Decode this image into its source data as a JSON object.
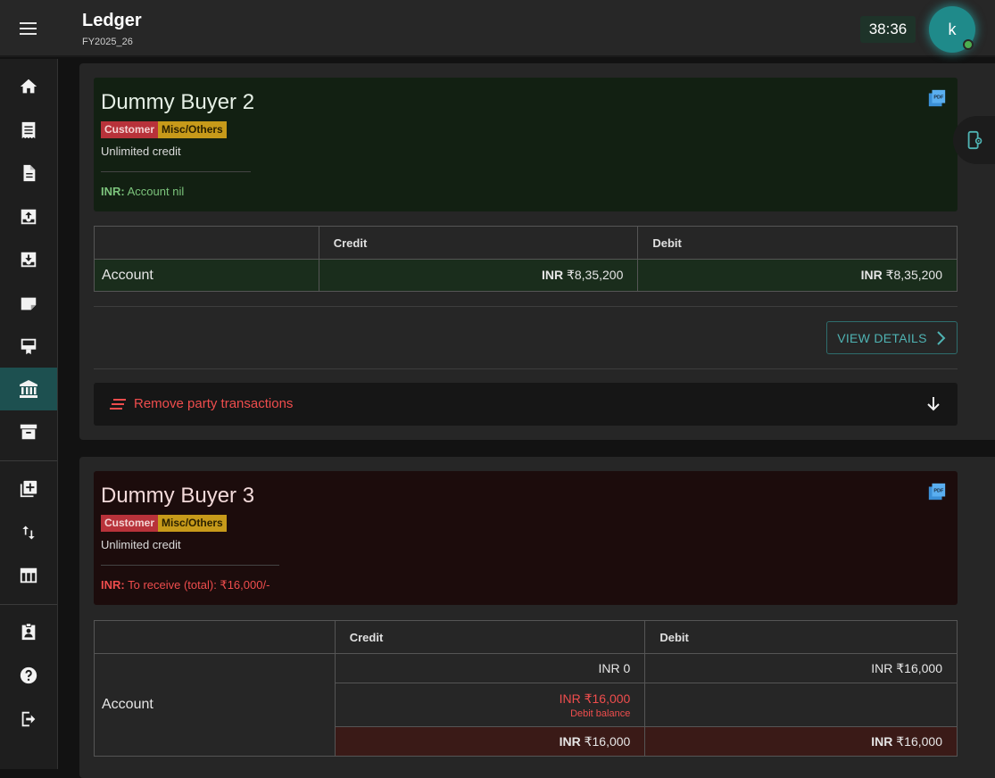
{
  "header": {
    "title": "Ledger",
    "subtitle": "FY2025_26",
    "timer": "38:36",
    "avatar_letter": "k"
  },
  "sidebar": {
    "items": [
      {
        "icon": "home-icon"
      },
      {
        "icon": "receipt-icon"
      },
      {
        "icon": "document-icon"
      },
      {
        "icon": "inbox-upload-icon"
      },
      {
        "icon": "inbox-download-icon"
      },
      {
        "icon": "note-icon"
      },
      {
        "icon": "desk-icon"
      },
      {
        "icon": "bank-icon",
        "active": true
      },
      {
        "icon": "archive-icon"
      },
      {
        "icon": "add-library-icon"
      },
      {
        "icon": "swap-vert-icon"
      },
      {
        "icon": "table-icon"
      },
      {
        "icon": "assignment-ind-icon"
      },
      {
        "icon": "help-icon"
      },
      {
        "icon": "logout-icon"
      }
    ]
  },
  "parties": [
    {
      "name": "Dummy Buyer 2",
      "tag1": "Customer",
      "tag2": "Misc/Others",
      "credit": "Unlimited credit",
      "balance_currency": "INR:",
      "balance_text": "Account nil",
      "table": {
        "col_credit": "Credit",
        "col_debit": "Debit",
        "row_label": "Account",
        "credit_currency": "INR",
        "credit_value": "₹8,35,200",
        "debit_currency": "INR",
        "debit_value": "₹8,35,200"
      },
      "view_details": "VIEW DETAILS",
      "remove_label": "Remove party transactions"
    },
    {
      "name": "Dummy Buyer 3",
      "tag1": "Customer",
      "tag2": "Misc/Others",
      "credit": "Unlimited credit",
      "balance_currency": "INR:",
      "balance_text": "To receive (total): ₹16,000/-",
      "table": {
        "col_credit": "Credit",
        "col_debit": "Debit",
        "row_label": "Account",
        "r1_credit": "INR 0",
        "r1_debit": "INR ₹16,000",
        "r2_credit": "INR ₹16,000",
        "r2_note": "Debit balance",
        "r3_credit_currency": "INR",
        "r3_credit_value": "₹16,000",
        "r3_debit_currency": "INR",
        "r3_debit_value": "₹16,000"
      }
    }
  ],
  "colors": {
    "accent": "#4fb3b3",
    "positive": "#7cc47c",
    "negative": "#ef4d4d"
  }
}
